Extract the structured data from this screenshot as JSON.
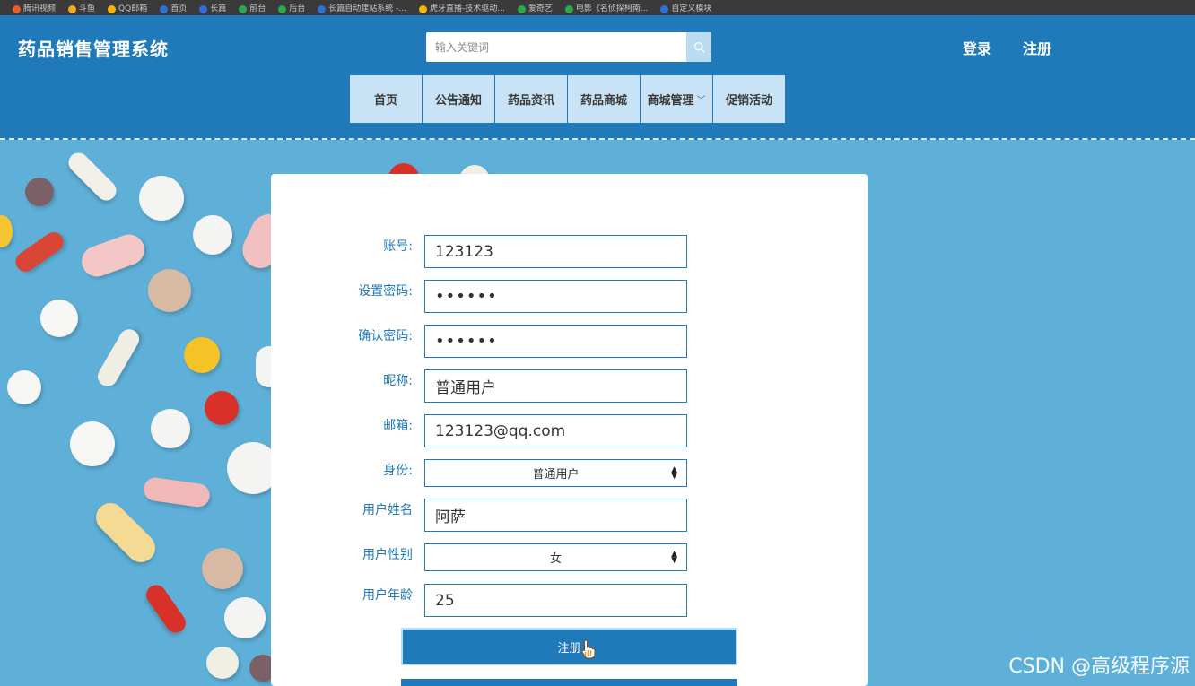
{
  "browser": {
    "bookmarks": [
      {
        "label": "腾讯视频",
        "color": "#e85d2a"
      },
      {
        "label": "斗鱼",
        "color": "#f5a623"
      },
      {
        "label": "QQ邮箱",
        "color": "#f5b400"
      },
      {
        "label": "首页",
        "color": "#2f6fd8"
      },
      {
        "label": "长篇",
        "color": "#2f6fd8"
      },
      {
        "label": "前台",
        "color": "#2ea84e"
      },
      {
        "label": "后台",
        "color": "#2ea84e"
      },
      {
        "label": "长篇自动建站系统 -...",
        "color": "#2f6fd8"
      },
      {
        "label": "虎牙直播-技术驱动...",
        "color": "#f5b400"
      },
      {
        "label": "爱奇艺",
        "color": "#2ea84e"
      },
      {
        "label": "电影《名侦探柯南...",
        "color": "#2ea84e"
      },
      {
        "label": "自定义模块",
        "color": "#2f6fd8"
      }
    ]
  },
  "header": {
    "title": "药品销售管理系统",
    "search_placeholder": "输入关键词",
    "login_label": "登录",
    "register_label": "注册"
  },
  "nav": [
    {
      "label": "首页",
      "dropdown": false
    },
    {
      "label": "公告通知",
      "dropdown": false
    },
    {
      "label": "药品资讯",
      "dropdown": false
    },
    {
      "label": "药品商城",
      "dropdown": false
    },
    {
      "label": "商城管理",
      "dropdown": true
    },
    {
      "label": "促销活动",
      "dropdown": false
    }
  ],
  "form": {
    "account_label": "账号:",
    "account_value": "123123",
    "password_label": "设置密码:",
    "password_value": "123123",
    "confirm_label": "确认密码:",
    "confirm_value": "123123",
    "nickname_label": "昵称:",
    "nickname_value": "普通用户",
    "email_label": "邮箱:",
    "email_value": "123123@qq.com",
    "role_label": "身份:",
    "role_value": "普通用户",
    "name_label": "用户姓名",
    "name_value": "阿萨",
    "gender_label": "用户性别",
    "gender_value": "女",
    "age_label": "用户年龄",
    "age_value": "25",
    "submit_label": "注册"
  },
  "watermark": "CSDN @高级程序源",
  "colors": {
    "primary": "#2079b8",
    "nav_bg": "#c8e3f5",
    "page_bg": "#5fb0d8"
  }
}
